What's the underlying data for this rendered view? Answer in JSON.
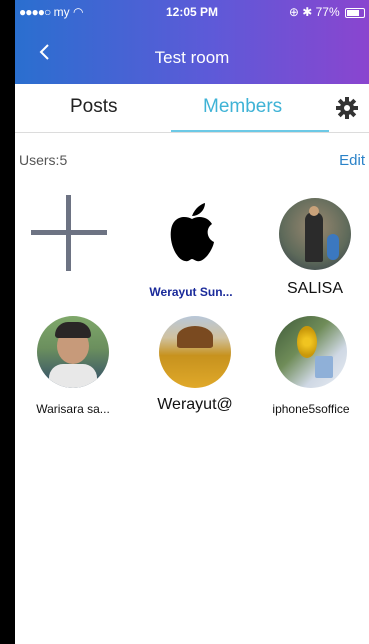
{
  "status": {
    "carrier": "my",
    "time": "12:05 PM",
    "battery": "77%"
  },
  "header": {
    "title": "Test room"
  },
  "tabs": [
    {
      "label": "Posts",
      "active": false
    },
    {
      "label": "Members",
      "active": true
    }
  ],
  "members_section": {
    "count_label": "Users:5",
    "edit_label": "Edit"
  },
  "members": [
    {
      "name": "Werayut Sun..."
    },
    {
      "name": "SALISA"
    },
    {
      "name": "Warisara  sa..."
    },
    {
      "name": "Werayut@"
    },
    {
      "name": "iphone5soffice"
    }
  ],
  "colors": {
    "header_start": "#2a6fcf",
    "header_end": "#8a45cf",
    "active_tab": "#3fb3d6",
    "edit": "#2a82c8",
    "member_link": "#1a2a9a"
  }
}
